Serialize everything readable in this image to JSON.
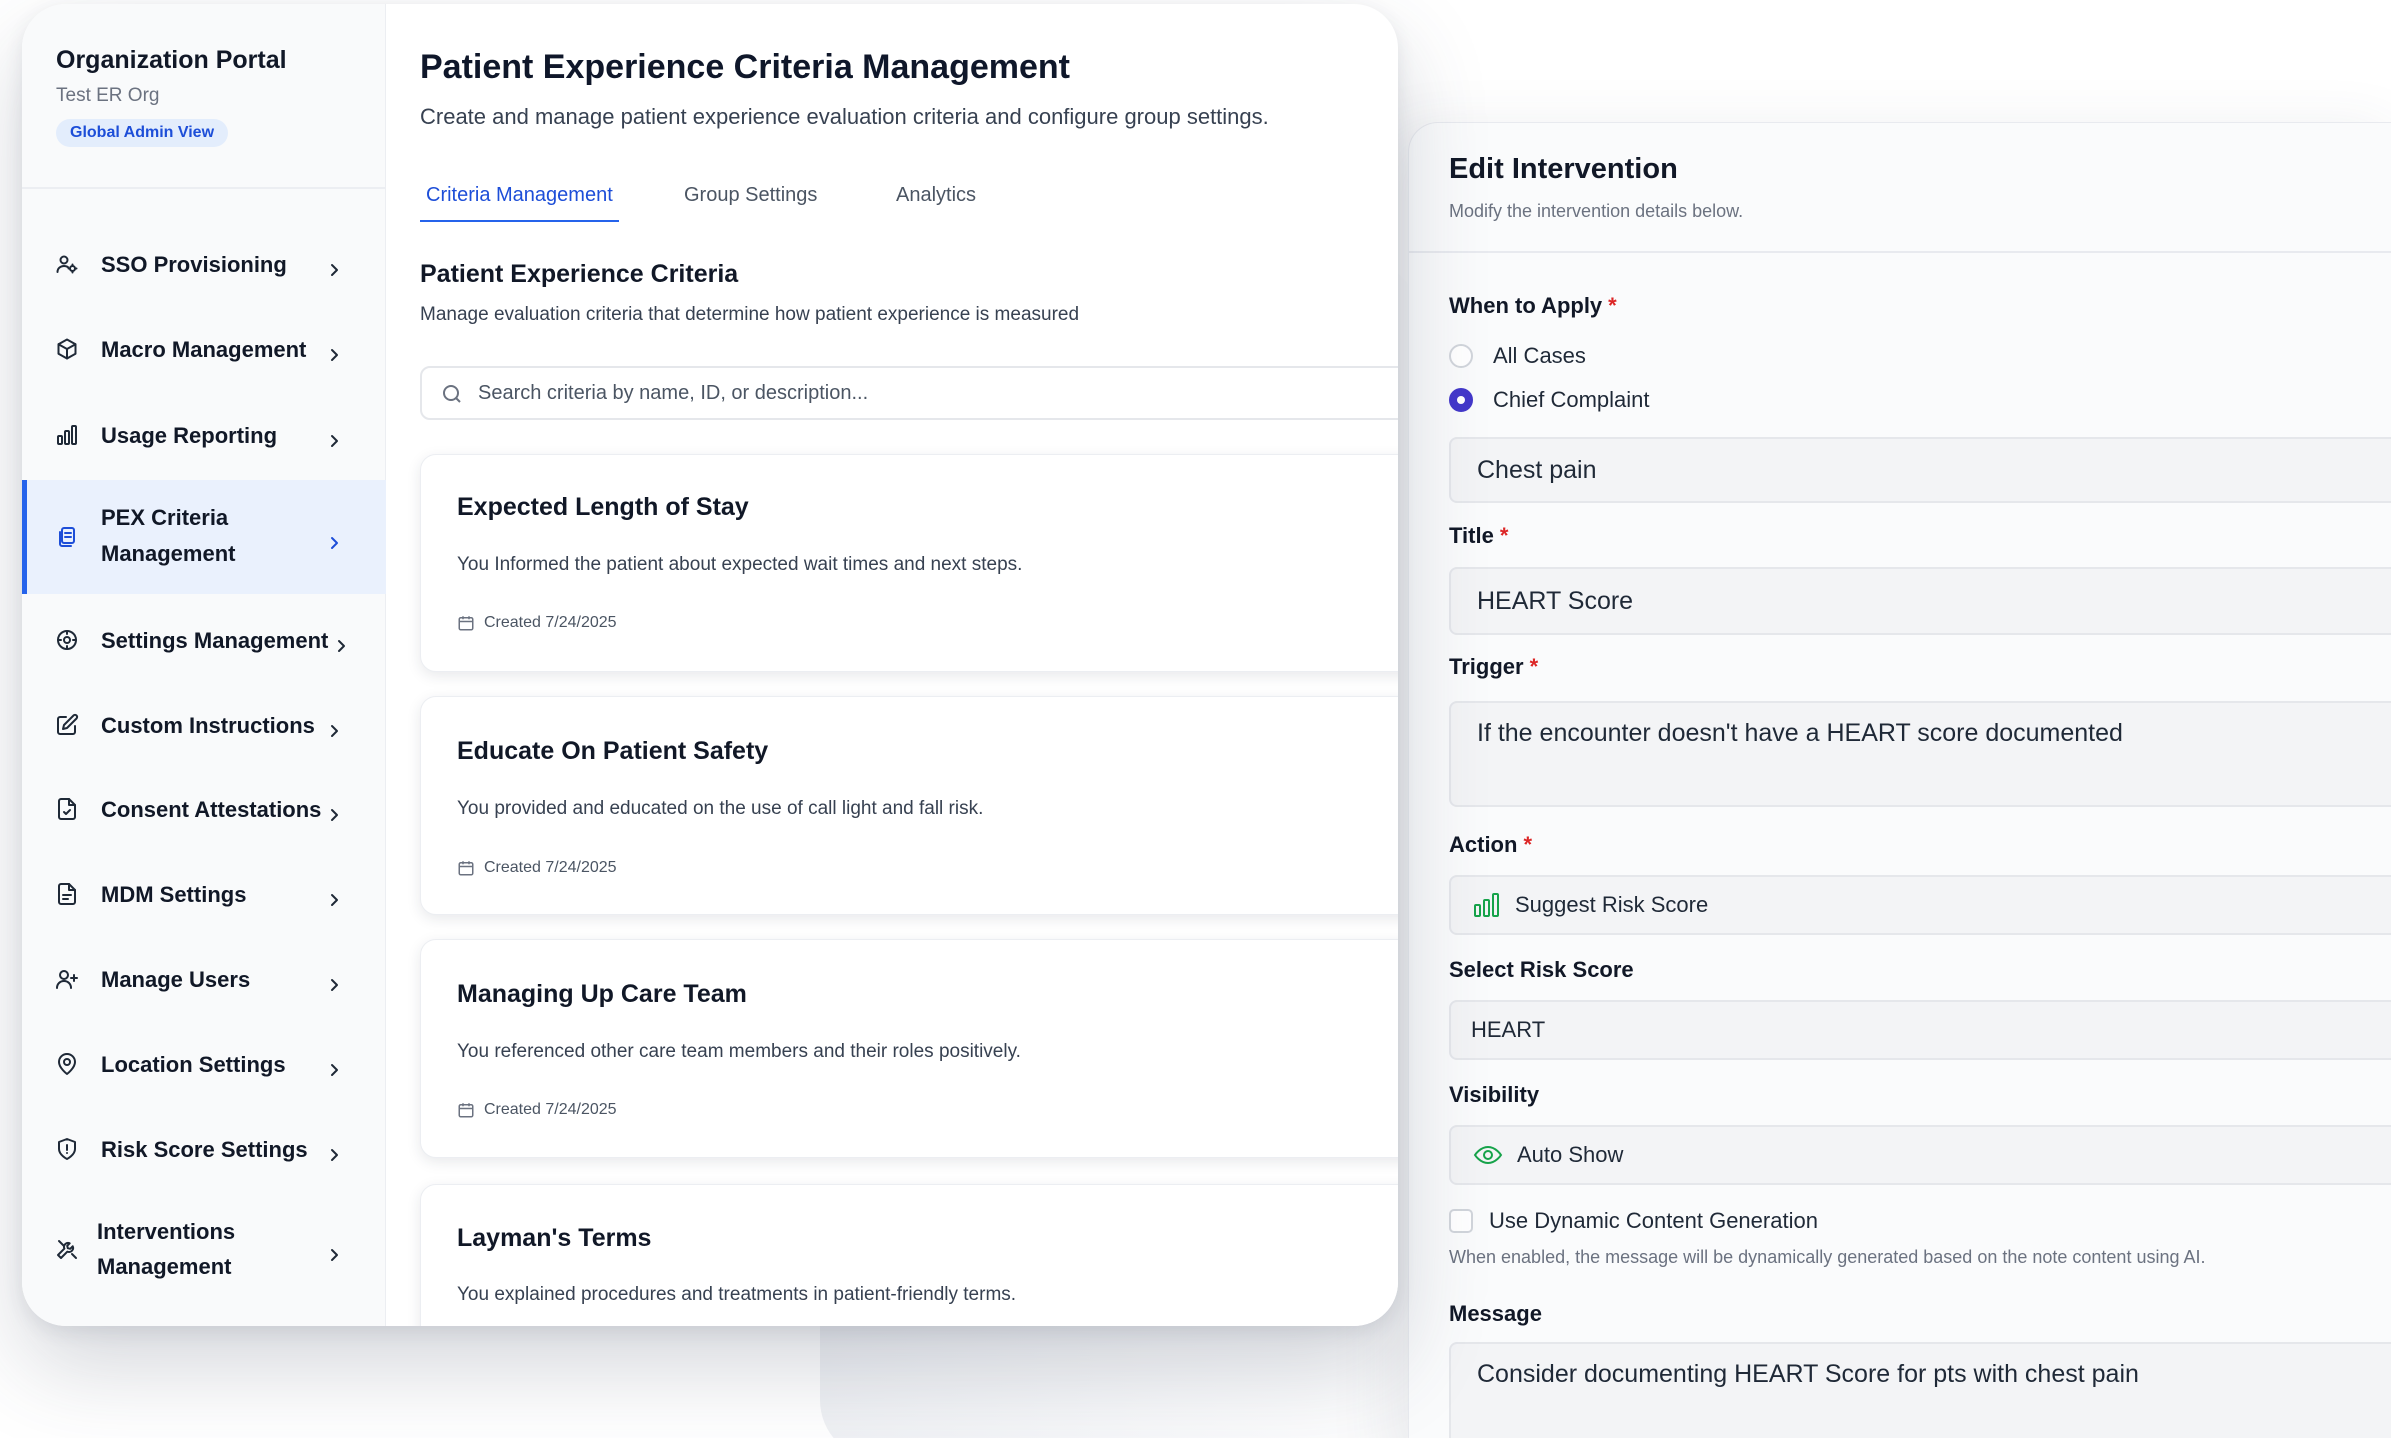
{
  "org": {
    "name": "Organization Portal",
    "subtitle": "Test ER Org",
    "badge": "Global Admin View"
  },
  "sidebar": {
    "items": [
      {
        "label": "SSO Provisioning",
        "icon": "users-cog-icon"
      },
      {
        "label": "Macro Management",
        "icon": "box-icon"
      },
      {
        "label": "Usage Reporting",
        "icon": "bar-chart-icon"
      },
      {
        "label_line1": "PEX Criteria",
        "label_line2": "Management",
        "icon": "files-icon",
        "active": true
      },
      {
        "label": "Settings Management",
        "icon": "gear-icon"
      },
      {
        "label": "Custom Instructions",
        "icon": "edit-icon"
      },
      {
        "label": "Consent Attestations",
        "icon": "file-check-icon"
      },
      {
        "label": "MDM Settings",
        "icon": "file-text-icon"
      },
      {
        "label": "Manage Users",
        "icon": "user-plus-icon"
      },
      {
        "label": "Location Settings",
        "icon": "map-pin-icon"
      },
      {
        "label": "Risk Score Settings",
        "icon": "shield-icon"
      },
      {
        "label_line1": "Interventions",
        "label_line2": "Management",
        "icon": "tools-icon"
      }
    ]
  },
  "page": {
    "title": "Patient Experience Criteria Management",
    "subtitle": "Create and manage patient experience evaluation criteria and configure group settings."
  },
  "tabs": [
    {
      "label": "Criteria Management",
      "active": true
    },
    {
      "label": "Group Settings"
    },
    {
      "label": "Analytics"
    }
  ],
  "section": {
    "title": "Patient Experience Criteria",
    "subtitle": "Manage evaluation criteria that determine how patient experience is measured"
  },
  "search": {
    "placeholder": "Search criteria by name, ID, or description...",
    "value": ""
  },
  "criteria": [
    {
      "title": "Expected Length of Stay",
      "description": "You Informed the patient about expected wait times and next steps.",
      "created": "Created 7/24/2025"
    },
    {
      "title": "Educate On Patient Safety",
      "description": "You provided and educated on the use of call light and fall risk.",
      "created": "Created 7/24/2025"
    },
    {
      "title": "Managing Up Care Team",
      "description": "You referenced other care team members and their roles positively.",
      "created": "Created 7/24/2025"
    },
    {
      "title": "Layman's Terms",
      "description": "You explained procedures and treatments in patient-friendly terms."
    }
  ],
  "edit_panel": {
    "title": "Edit Intervention",
    "subtitle": "Modify the intervention details below.",
    "when_to_apply": {
      "label": "When to Apply",
      "required": "*",
      "options": [
        "All Cases",
        "Chief Complaint"
      ],
      "selected": "Chief Complaint",
      "complaint_value": "Chest pain"
    },
    "title_field": {
      "label": "Title",
      "required": "*",
      "value": "HEART Score"
    },
    "trigger": {
      "label": "Trigger",
      "required": "*",
      "value": "If the encounter doesn't have a HEART score documented"
    },
    "action": {
      "label": "Action",
      "required": "*",
      "value": "Suggest Risk Score",
      "icon": "bar-chart-icon",
      "icon_color": "#16a34a"
    },
    "risk_score": {
      "label": "Select Risk Score",
      "value": "HEART"
    },
    "visibility": {
      "label": "Visibility",
      "value": "Auto Show",
      "icon": "eye-icon",
      "icon_color": "#16a34a"
    },
    "dynamic": {
      "label": "Use Dynamic Content Generation",
      "checked": false,
      "hint": "When enabled, the message will be dynamically generated based on the note content using AI."
    },
    "message": {
      "label": "Message",
      "value": "Consider documenting HEART Score for pts with chest pain"
    }
  },
  "colors": {
    "accent": "#2563eb",
    "active_bg": "#eaf1fd",
    "radio_selected": "#4338ca",
    "required": "#dc2626",
    "success": "#16a34a"
  }
}
